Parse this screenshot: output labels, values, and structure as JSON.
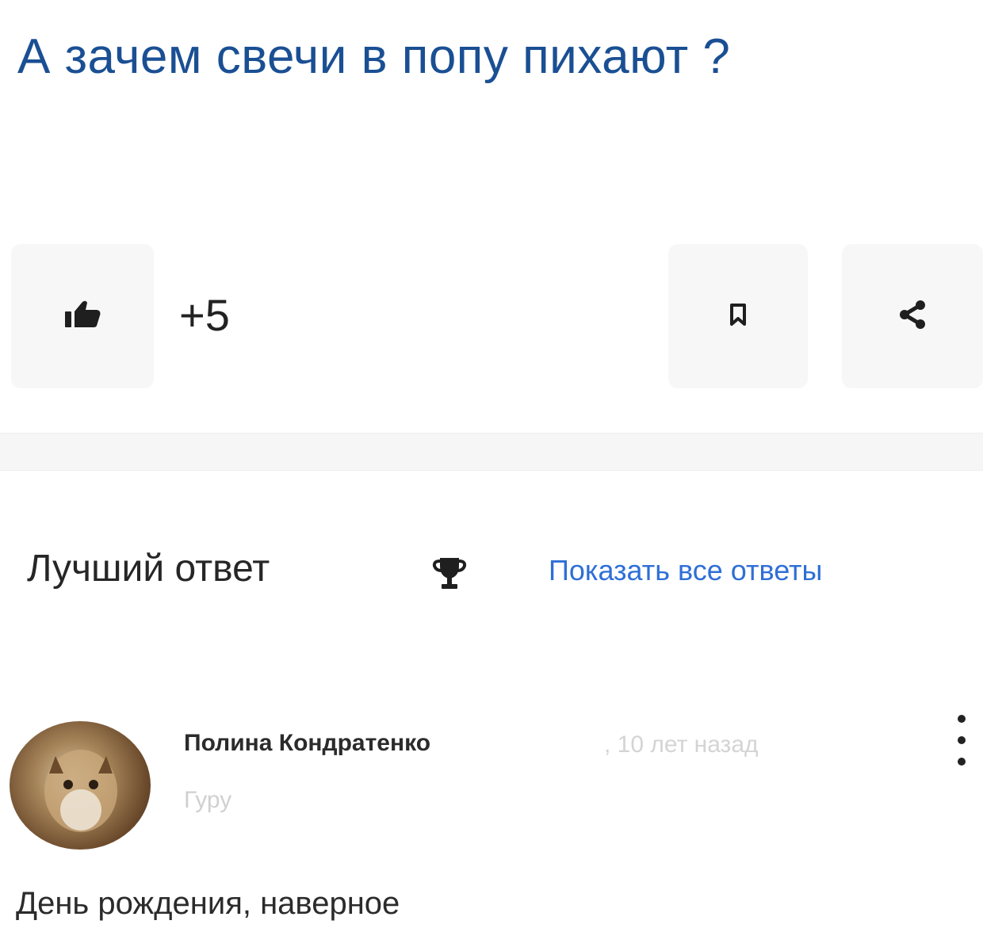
{
  "question": {
    "title": "А зачем свечи в попу пихают ?"
  },
  "actions": {
    "like_icon": "thumbs-up-icon",
    "like_count": "+5",
    "bookmark_icon": "bookmark-icon",
    "share_icon": "share-icon"
  },
  "answers": {
    "best_answer_label": "Лучший ответ",
    "trophy_icon": "trophy-icon",
    "show_all_label": "Показать все ответы",
    "best": {
      "author": "Полина Кондратенко",
      "time": ", 10 лет назад",
      "rank": "Гуру",
      "avatar": "avatar-photo",
      "more_icon": "more-vertical-icon",
      "text": "День рождения, наверное"
    }
  },
  "colors": {
    "title": "#1a4f93",
    "link": "#2f6fd6",
    "button_bg": "#f7f7f8",
    "text": "#262626",
    "muted": "#d0d0d0"
  }
}
